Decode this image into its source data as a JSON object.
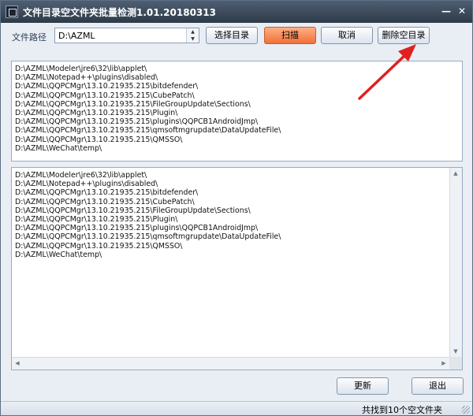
{
  "window": {
    "title": "文件目录空文件夹批量检测1.01.20180313",
    "minimize_glyph": "—",
    "close_glyph": "✕"
  },
  "toolbar": {
    "path_label": "文件路径",
    "path_value": "D:\\AZML",
    "select_dir_label": "选择目录",
    "scan_label": "扫描",
    "cancel_label": "取消",
    "delete_empty_label": "删除空目录"
  },
  "top_list": {
    "items": [
      "D:\\AZML\\Modeler\\jre6\\32\\lib\\applet\\",
      "D:\\AZML\\Notepad++\\plugins\\disabled\\",
      "D:\\AZML\\QQPCMgr\\13.10.21935.215\\bitdefender\\",
      "D:\\AZML\\QQPCMgr\\13.10.21935.215\\CubePatch\\",
      "D:\\AZML\\QQPCMgr\\13.10.21935.215\\FileGroupUpdate\\Sections\\",
      "D:\\AZML\\QQPCMgr\\13.10.21935.215\\Plugin\\",
      "D:\\AZML\\QQPCMgr\\13.10.21935.215\\plugins\\QQPCB1AndroidJmp\\",
      "D:\\AZML\\QQPCMgr\\13.10.21935.215\\qmsoftmgrupdate\\DataUpdateFile\\",
      "D:\\AZML\\QQPCMgr\\13.10.21935.215\\QMSSO\\",
      "D:\\AZML\\WeChat\\temp\\"
    ]
  },
  "bottom_list": {
    "items": [
      "D:\\AZML\\Modeler\\jre6\\32\\lib\\applet\\",
      "D:\\AZML\\Notepad++\\plugins\\disabled\\",
      "D:\\AZML\\QQPCMgr\\13.10.21935.215\\bitdefender\\",
      "D:\\AZML\\QQPCMgr\\13.10.21935.215\\CubePatch\\",
      "D:\\AZML\\QQPCMgr\\13.10.21935.215\\FileGroupUpdate\\Sections\\",
      "D:\\AZML\\QQPCMgr\\13.10.21935.215\\Plugin\\",
      "D:\\AZML\\QQPCMgr\\13.10.21935.215\\plugins\\QQPCB1AndroidJmp\\",
      "D:\\AZML\\QQPCMgr\\13.10.21935.215\\qmsoftmgrupdate\\DataUpdateFile\\",
      "D:\\AZML\\QQPCMgr\\13.10.21935.215\\QMSSO\\",
      "D:\\AZML\\WeChat\\temp\\"
    ]
  },
  "footer": {
    "refresh_label": "更新",
    "exit_label": "退出"
  },
  "status": {
    "text": "共找到10个空文件夹"
  },
  "colors": {
    "scan_accent": "#f0703a",
    "annotation_arrow": "#e02020"
  }
}
